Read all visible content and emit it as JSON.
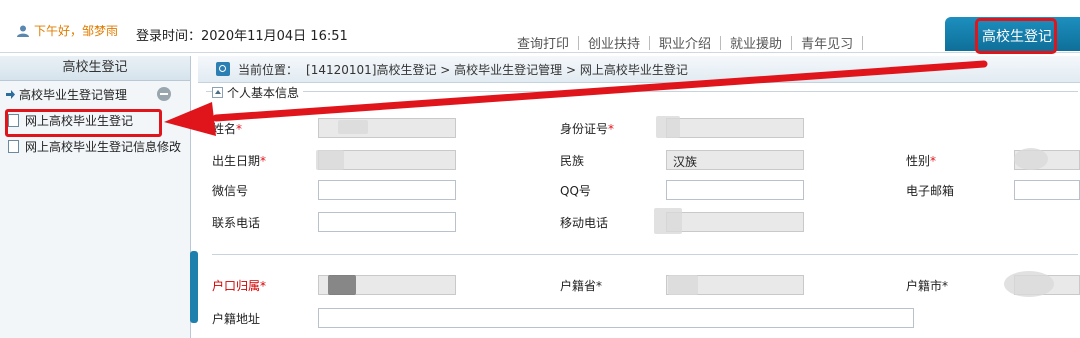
{
  "header": {
    "greeting": "下午好，邹梦雨",
    "login_label": "登录时间：2020年11月04日 16:51",
    "nav": [
      "查询打印",
      "创业扶持",
      "职业介绍",
      "就业援助",
      "青年见习"
    ],
    "active_tab": "高校生登记"
  },
  "sidebar": {
    "title": "高校生登记",
    "group": "高校毕业生登记管理",
    "items": [
      "网上高校毕业生登记",
      "网上高校毕业生登记信息修改"
    ]
  },
  "breadcrumb": {
    "label": "当前位置：",
    "path": "[14120101]高校生登记 > 高校毕业生登记管理 > 网上高校毕业生登记"
  },
  "section": {
    "title": "个人基本信息"
  },
  "form": {
    "name_label": "姓名",
    "id_label": "身份证号",
    "birth_label": "出生日期",
    "ethnic_label": "民族",
    "ethnic_value": "汉族",
    "gender_label": "性别",
    "wechat_label": "微信号",
    "qq_label": "QQ号",
    "email_label": "电子邮箱",
    "phone_label": "联系电话",
    "mobile_label": "移动电话",
    "hukou_label": "户口归属",
    "province_label": "户籍省",
    "city_label": "户籍市",
    "address_label": "户籍地址",
    "required_mark": "*"
  },
  "colors": {
    "accent": "#1d8fbf",
    "highlight": "#e0141b",
    "greeting": "#e07c00"
  }
}
